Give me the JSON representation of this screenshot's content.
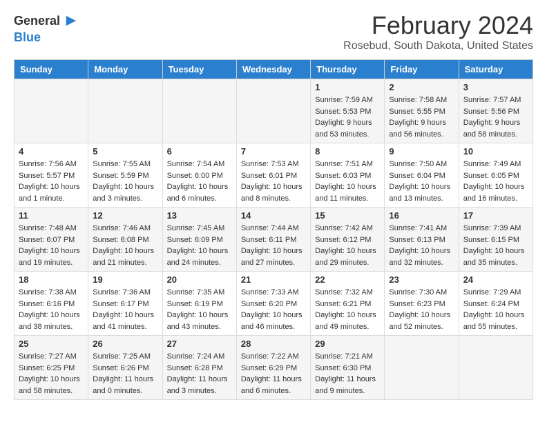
{
  "header": {
    "logo_general": "General",
    "logo_blue": "Blue",
    "month": "February 2024",
    "location": "Rosebud, South Dakota, United States"
  },
  "days_of_week": [
    "Sunday",
    "Monday",
    "Tuesday",
    "Wednesday",
    "Thursday",
    "Friday",
    "Saturday"
  ],
  "weeks": [
    [
      {
        "day": "",
        "info": ""
      },
      {
        "day": "",
        "info": ""
      },
      {
        "day": "",
        "info": ""
      },
      {
        "day": "",
        "info": ""
      },
      {
        "day": "1",
        "info": "Sunrise: 7:59 AM\nSunset: 5:53 PM\nDaylight: 9 hours\nand 53 minutes."
      },
      {
        "day": "2",
        "info": "Sunrise: 7:58 AM\nSunset: 5:55 PM\nDaylight: 9 hours\nand 56 minutes."
      },
      {
        "day": "3",
        "info": "Sunrise: 7:57 AM\nSunset: 5:56 PM\nDaylight: 9 hours\nand 58 minutes."
      }
    ],
    [
      {
        "day": "4",
        "info": "Sunrise: 7:56 AM\nSunset: 5:57 PM\nDaylight: 10 hours\nand 1 minute."
      },
      {
        "day": "5",
        "info": "Sunrise: 7:55 AM\nSunset: 5:59 PM\nDaylight: 10 hours\nand 3 minutes."
      },
      {
        "day": "6",
        "info": "Sunrise: 7:54 AM\nSunset: 6:00 PM\nDaylight: 10 hours\nand 6 minutes."
      },
      {
        "day": "7",
        "info": "Sunrise: 7:53 AM\nSunset: 6:01 PM\nDaylight: 10 hours\nand 8 minutes."
      },
      {
        "day": "8",
        "info": "Sunrise: 7:51 AM\nSunset: 6:03 PM\nDaylight: 10 hours\nand 11 minutes."
      },
      {
        "day": "9",
        "info": "Sunrise: 7:50 AM\nSunset: 6:04 PM\nDaylight: 10 hours\nand 13 minutes."
      },
      {
        "day": "10",
        "info": "Sunrise: 7:49 AM\nSunset: 6:05 PM\nDaylight: 10 hours\nand 16 minutes."
      }
    ],
    [
      {
        "day": "11",
        "info": "Sunrise: 7:48 AM\nSunset: 6:07 PM\nDaylight: 10 hours\nand 19 minutes."
      },
      {
        "day": "12",
        "info": "Sunrise: 7:46 AM\nSunset: 6:08 PM\nDaylight: 10 hours\nand 21 minutes."
      },
      {
        "day": "13",
        "info": "Sunrise: 7:45 AM\nSunset: 6:09 PM\nDaylight: 10 hours\nand 24 minutes."
      },
      {
        "day": "14",
        "info": "Sunrise: 7:44 AM\nSunset: 6:11 PM\nDaylight: 10 hours\nand 27 minutes."
      },
      {
        "day": "15",
        "info": "Sunrise: 7:42 AM\nSunset: 6:12 PM\nDaylight: 10 hours\nand 29 minutes."
      },
      {
        "day": "16",
        "info": "Sunrise: 7:41 AM\nSunset: 6:13 PM\nDaylight: 10 hours\nand 32 minutes."
      },
      {
        "day": "17",
        "info": "Sunrise: 7:39 AM\nSunset: 6:15 PM\nDaylight: 10 hours\nand 35 minutes."
      }
    ],
    [
      {
        "day": "18",
        "info": "Sunrise: 7:38 AM\nSunset: 6:16 PM\nDaylight: 10 hours\nand 38 minutes."
      },
      {
        "day": "19",
        "info": "Sunrise: 7:36 AM\nSunset: 6:17 PM\nDaylight: 10 hours\nand 41 minutes."
      },
      {
        "day": "20",
        "info": "Sunrise: 7:35 AM\nSunset: 6:19 PM\nDaylight: 10 hours\nand 43 minutes."
      },
      {
        "day": "21",
        "info": "Sunrise: 7:33 AM\nSunset: 6:20 PM\nDaylight: 10 hours\nand 46 minutes."
      },
      {
        "day": "22",
        "info": "Sunrise: 7:32 AM\nSunset: 6:21 PM\nDaylight: 10 hours\nand 49 minutes."
      },
      {
        "day": "23",
        "info": "Sunrise: 7:30 AM\nSunset: 6:23 PM\nDaylight: 10 hours\nand 52 minutes."
      },
      {
        "day": "24",
        "info": "Sunrise: 7:29 AM\nSunset: 6:24 PM\nDaylight: 10 hours\nand 55 minutes."
      }
    ],
    [
      {
        "day": "25",
        "info": "Sunrise: 7:27 AM\nSunset: 6:25 PM\nDaylight: 10 hours\nand 58 minutes."
      },
      {
        "day": "26",
        "info": "Sunrise: 7:25 AM\nSunset: 6:26 PM\nDaylight: 11 hours\nand 0 minutes."
      },
      {
        "day": "27",
        "info": "Sunrise: 7:24 AM\nSunset: 6:28 PM\nDaylight: 11 hours\nand 3 minutes."
      },
      {
        "day": "28",
        "info": "Sunrise: 7:22 AM\nSunset: 6:29 PM\nDaylight: 11 hours\nand 6 minutes."
      },
      {
        "day": "29",
        "info": "Sunrise: 7:21 AM\nSunset: 6:30 PM\nDaylight: 11 hours\nand 9 minutes."
      },
      {
        "day": "",
        "info": ""
      },
      {
        "day": "",
        "info": ""
      }
    ]
  ]
}
